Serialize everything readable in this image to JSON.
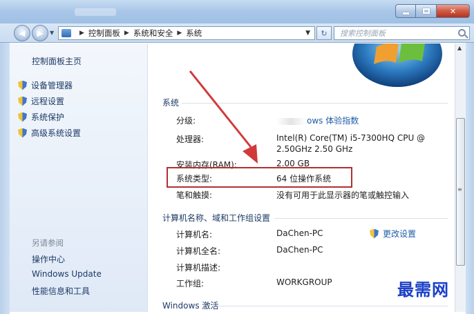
{
  "window": {
    "minimize_glyph": "",
    "maximize_glyph": "",
    "close_glyph": "✕"
  },
  "address_bar": {
    "back_glyph": "◀",
    "forward_glyph": "▶",
    "breadcrumbs": [
      "控制面板",
      "系统和安全",
      "系统"
    ],
    "refresh_glyph": "↻",
    "search_placeholder": "搜索控制面板"
  },
  "sidebar": {
    "home": "控制面板主页",
    "items": [
      {
        "label": "设备管理器",
        "icon": "shield-icon"
      },
      {
        "label": "远程设置",
        "icon": "shield-icon"
      },
      {
        "label": "系统保护",
        "icon": "shield-icon"
      },
      {
        "label": "高级系统设置",
        "icon": "shield-icon"
      }
    ],
    "see_also": "另请参阅",
    "links": [
      "操作中心",
      "Windows Update",
      "性能信息和工具"
    ]
  },
  "system": {
    "section_title": "系统",
    "rows": [
      {
        "label": "分级:",
        "value": "ows 体验指数",
        "is_link": true
      },
      {
        "label": "处理器:",
        "value": "Intel(R) Core(TM) i5-7300HQ CPU @",
        "value2": "2.50GHz   2.50 GHz"
      },
      {
        "label": "安装内存(RAM):",
        "value": "2.00 GB"
      },
      {
        "label": "系统类型:",
        "value": "64 位操作系统"
      },
      {
        "label": "笔和触摸:",
        "value": "没有可用于此显示器的笔或触控输入"
      }
    ]
  },
  "computer": {
    "section_title": "计算机名称、域和工作组设置",
    "change_settings": "更改设置",
    "rows": [
      {
        "label": "计算机名:",
        "value": "DaChen-PC"
      },
      {
        "label": "计算机全名:",
        "value": "DaChen-PC"
      },
      {
        "label": "计算机描述:",
        "value": ""
      },
      {
        "label": "工作组:",
        "value": "WORKGROUP"
      }
    ]
  },
  "activation": {
    "section_title": "Windows 激活"
  },
  "watermark": "最需网",
  "colors": {
    "highlight_border": "#b03030",
    "arrow": "#d03a3a",
    "link": "#1f5ca8",
    "watermark": "#1a3fc7"
  }
}
